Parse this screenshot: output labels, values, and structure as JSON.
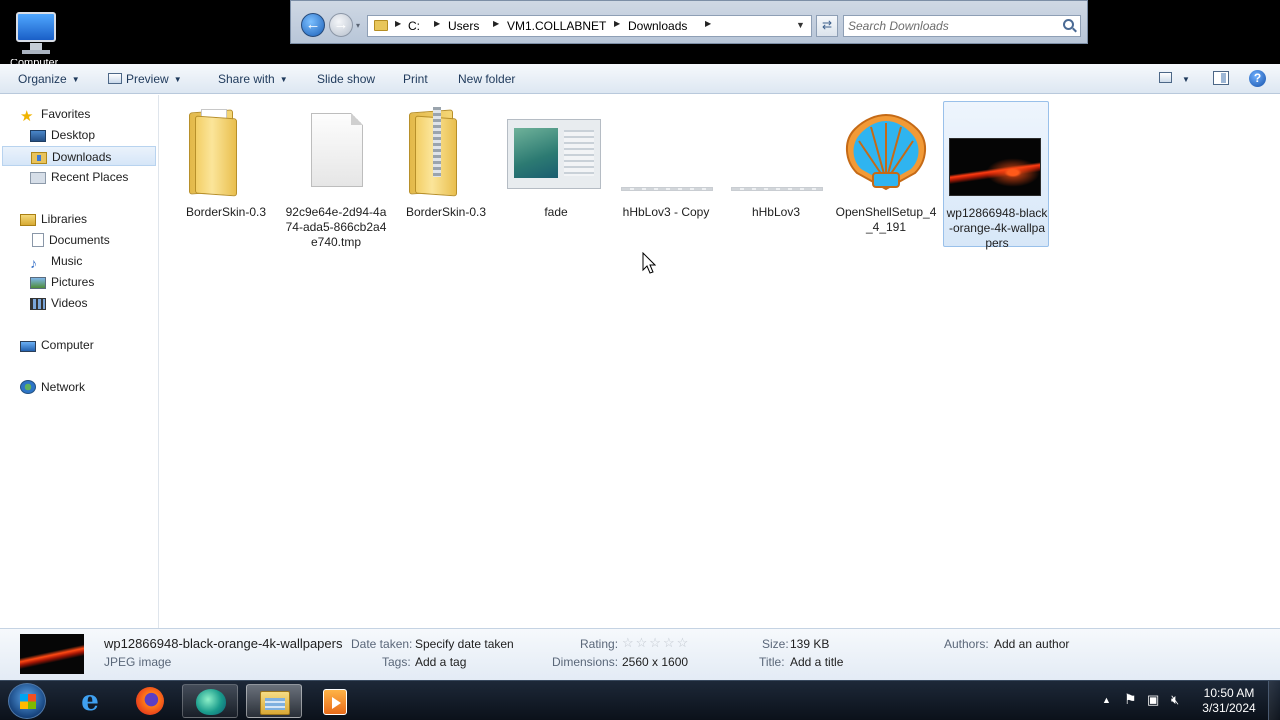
{
  "desktop": {
    "icon_label": "Computer"
  },
  "address": {
    "crumbs": [
      "C:",
      "Users",
      "VM1.COLLABNET",
      "Downloads"
    ],
    "search_placeholder": "Search Downloads"
  },
  "toolbar": {
    "organize": "Organize",
    "preview": "Preview",
    "share_with": "Share with",
    "slide_show": "Slide show",
    "print": "Print",
    "new_folder": "New folder"
  },
  "nav": {
    "favorites": "Favorites",
    "desktop": "Desktop",
    "downloads": "Downloads",
    "recent_places": "Recent Places",
    "libraries": "Libraries",
    "documents": "Documents",
    "music": "Music",
    "pictures": "Pictures",
    "videos": "Videos",
    "computer": "Computer",
    "network": "Network"
  },
  "files": [
    {
      "name": "BorderSkin-0.3",
      "kind": "folder"
    },
    {
      "name": "92c9e64e-2d94-4a74-ada5-866cb2a4e740.tmp",
      "kind": "tmp-file"
    },
    {
      "name": "BorderSkin-0.3",
      "kind": "zip-folder"
    },
    {
      "name": "fade",
      "kind": "image"
    },
    {
      "name": "hHbLov3 - Copy",
      "kind": "image-strip"
    },
    {
      "name": "hHbLov3",
      "kind": "image-strip"
    },
    {
      "name": "OpenShellSetup_4_4_191",
      "kind": "installer"
    },
    {
      "name": "wp12866948-black-orange-4k-wallpapers",
      "kind": "image",
      "selected": true
    }
  ],
  "details": {
    "name": "wp12866948-black-orange-4k-wallpapers",
    "type": "JPEG image",
    "date_taken_label": "Date taken:",
    "date_taken_value": "Specify date taken",
    "tags_label": "Tags:",
    "tags_value": "Add a tag",
    "rating_label": "Rating:",
    "rating_stars": "☆☆☆☆☆",
    "dimensions_label": "Dimensions:",
    "dimensions_value": "2560 x 1600",
    "size_label": "Size:",
    "size_value": "139 KB",
    "title_label": "Title:",
    "title_value": "Add a title",
    "authors_label": "Authors:",
    "authors_value": "Add an author"
  },
  "taskbar": {
    "time": "10:50 AM",
    "date": "3/31/2024"
  }
}
